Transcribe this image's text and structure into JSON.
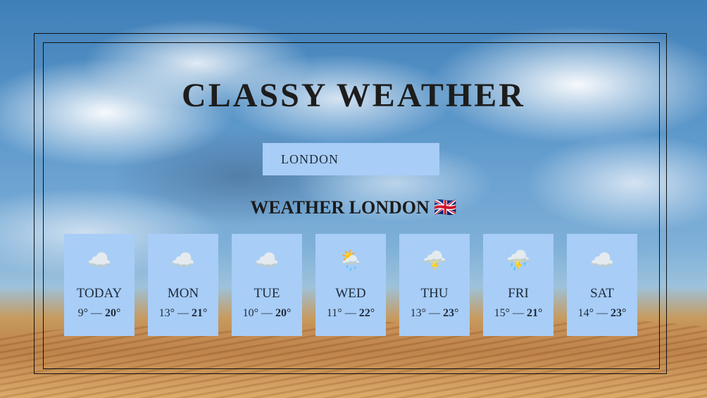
{
  "app": {
    "title": "CLASSY WEATHER"
  },
  "search": {
    "value": "LONDON"
  },
  "heading": {
    "text": "WEATHER LONDON 🇬🇧"
  },
  "days": [
    {
      "name": "TODAY",
      "icon": "☁️",
      "min": "9°",
      "max": "20°",
      "icon_name": "cloud-icon"
    },
    {
      "name": "MON",
      "icon": "☁️",
      "min": "13°",
      "max": "21°",
      "icon_name": "cloud-icon"
    },
    {
      "name": "TUE",
      "icon": "☁️",
      "min": "10°",
      "max": "20°",
      "icon_name": "cloud-icon"
    },
    {
      "name": "WED",
      "icon": "🌦️",
      "min": "11°",
      "max": "22°",
      "icon_name": "sun-rain-cloud-icon"
    },
    {
      "name": "THU",
      "icon": "🌩️",
      "min": "13°",
      "max": "23°",
      "icon_name": "lightning-cloud-icon"
    },
    {
      "name": "FRI",
      "icon": "⛈️",
      "min": "15°",
      "max": "21°",
      "icon_name": "thunderstorm-icon"
    },
    {
      "name": "SAT",
      "icon": "☁️",
      "min": "14°",
      "max": "23°",
      "icon_name": "cloud-icon"
    }
  ],
  "colors": {
    "card": "#a8cdf7",
    "frame": "#111111"
  }
}
